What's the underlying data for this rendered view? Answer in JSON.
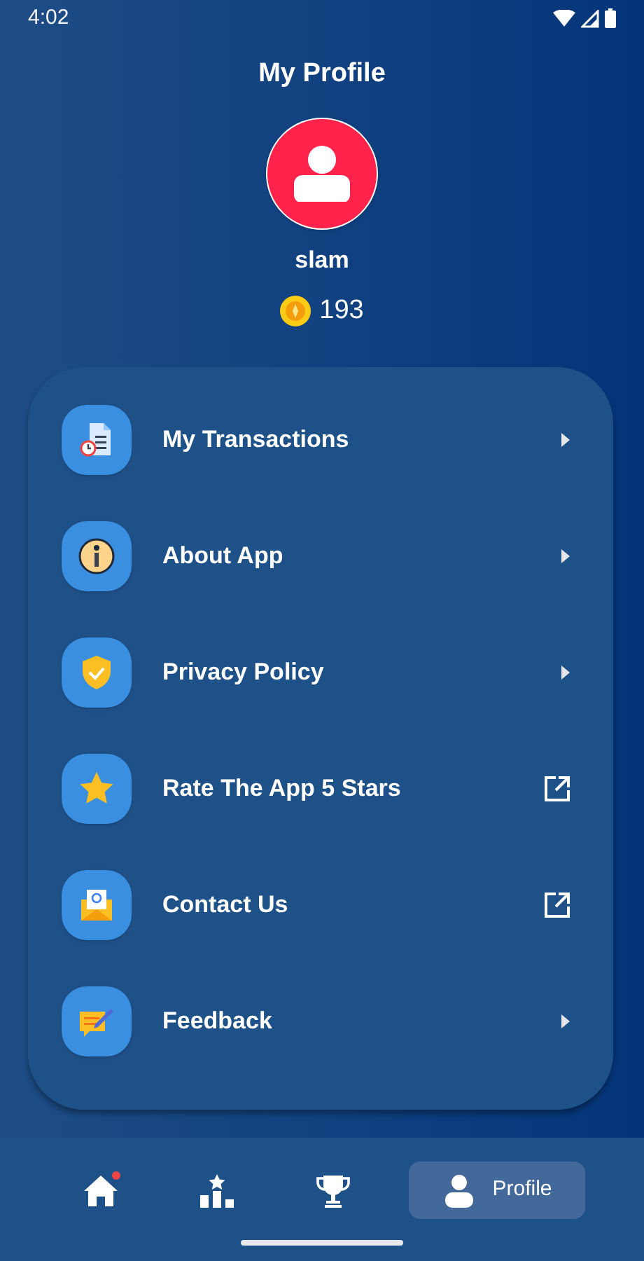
{
  "status_bar": {
    "time": "4:02"
  },
  "header": {
    "title": "My Profile"
  },
  "profile": {
    "name": "slam",
    "coins": "193"
  },
  "menu": [
    {
      "label": "My Transactions",
      "kind": "chevron"
    },
    {
      "label": "About App",
      "kind": "chevron"
    },
    {
      "label": "Privacy Policy",
      "kind": "chevron"
    },
    {
      "label": "Rate The App 5 Stars",
      "kind": "external"
    },
    {
      "label": "Contact Us",
      "kind": "external"
    },
    {
      "label": "Feedback",
      "kind": "chevron"
    }
  ],
  "bottom_nav": [
    {
      "kind": "home",
      "selected": false,
      "dot": true
    },
    {
      "kind": "leaderboard",
      "selected": false,
      "dot": false
    },
    {
      "kind": "trophy",
      "selected": false,
      "dot": false
    },
    {
      "kind": "profile",
      "label": "Profile",
      "selected": true,
      "dot": false
    }
  ]
}
